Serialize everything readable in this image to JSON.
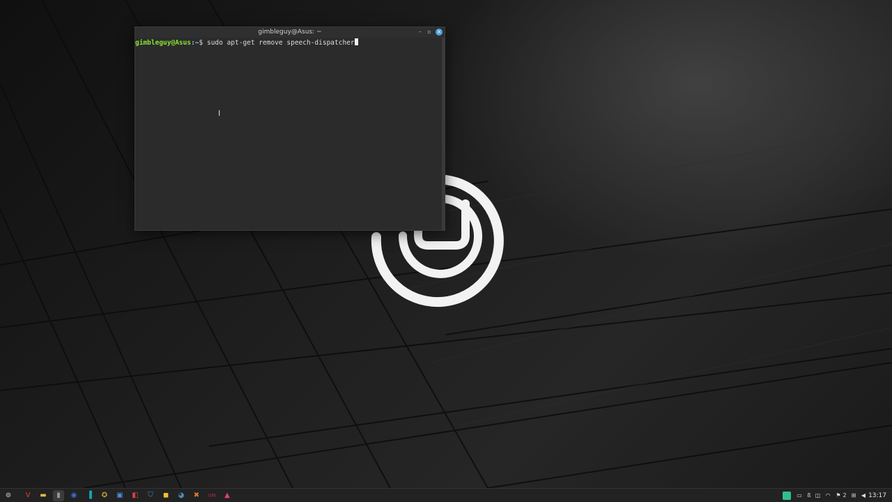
{
  "window": {
    "title": "gimbleguy@Asus: ~",
    "minimize_glyph": "–",
    "maximize_glyph": "▫",
    "close_glyph": "×"
  },
  "terminal": {
    "prompt_user": "gimbleguy@Asus",
    "prompt_path": ":~",
    "prompt_symbol": "$ ",
    "command": "sudo apt-get remove speech-dispatcher"
  },
  "taskbar": {
    "apps": [
      {
        "name": "menu-icon",
        "glyph": "⊚",
        "color": "#cfcfcf"
      },
      {
        "name": "vivaldi-icon",
        "glyph": "V",
        "color": "#ef3939"
      },
      {
        "name": "files-icon",
        "glyph": "▬",
        "color": "#e9b94a"
      },
      {
        "name": "terminal-icon",
        "glyph": "▮",
        "color": "#9a9a9a"
      },
      {
        "name": "app-blue-icon",
        "glyph": "◉",
        "color": "#3f6ed8"
      },
      {
        "name": "app-teal-icon",
        "glyph": "▐",
        "color": "#1aa0b0"
      },
      {
        "name": "app-gold-icon",
        "glyph": "✪",
        "color": "#c9a23a"
      },
      {
        "name": "app-window-icon",
        "glyph": "▣",
        "color": "#4f8fe0"
      },
      {
        "name": "app-red-icon",
        "glyph": "◧",
        "color": "#d94040"
      },
      {
        "name": "shield-icon",
        "glyph": "⛉",
        "color": "#3d8fd6"
      },
      {
        "name": "app-yellow-icon",
        "glyph": "◼",
        "color": "#f2c230"
      },
      {
        "name": "steam-icon",
        "glyph": "◕",
        "color": "#4a8ab8"
      },
      {
        "name": "app-orange-icon",
        "glyph": "✖",
        "color": "#e07a2a"
      },
      {
        "name": "vm-icon",
        "glyph": "VM",
        "color": "#b02a5a"
      },
      {
        "name": "image-viewer-icon",
        "glyph": "▲",
        "color": "#e0407a"
      }
    ],
    "tray": {
      "workspace_count": "2",
      "clock": "13:17"
    }
  },
  "colors": {
    "accent": "#4aa3df",
    "prompt_green": "#8ae234",
    "prompt_blue": "#9cc7f2"
  }
}
